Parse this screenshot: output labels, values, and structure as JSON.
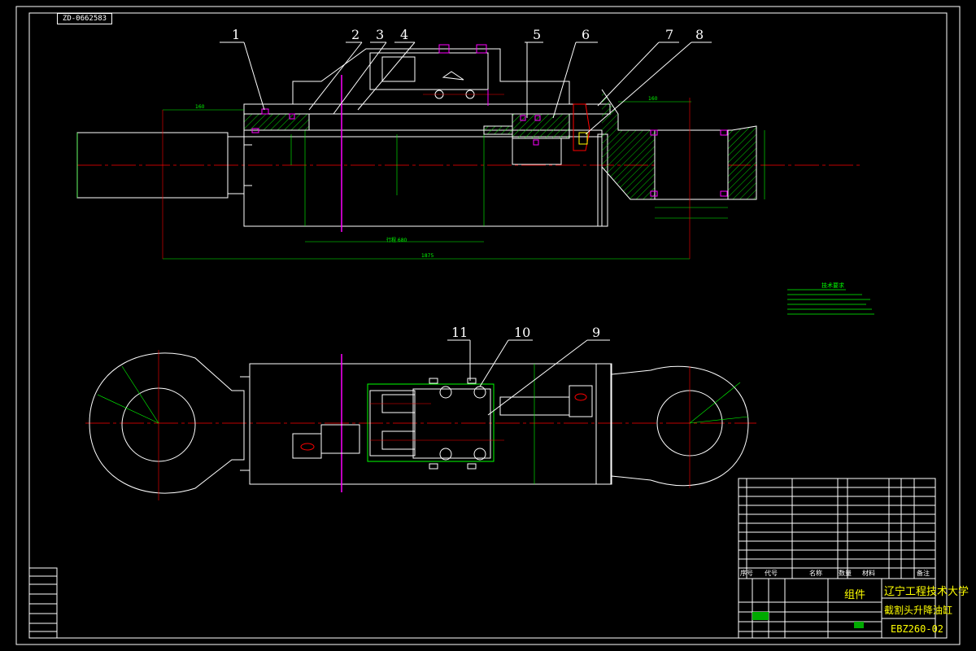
{
  "drawing_stamp": "ZD-0662583",
  "balloons": [
    "1",
    "2",
    "3",
    "4",
    "5",
    "6",
    "7",
    "8",
    "9",
    "10",
    "11"
  ],
  "title_block": {
    "university": "辽宁工程技术大学",
    "drawing_name": "截割头升降油缸",
    "drawing_code": "EBZ260-02",
    "component_label": "组件"
  },
  "notes_title": "技术要求",
  "dimensions": {
    "stroke_label": "行程 680",
    "total_length": "1875",
    "rod_left": "160",
    "rod_right": "160"
  },
  "bom_header": {
    "index": "序号",
    "code": "代号",
    "name": "名称",
    "qty": "数量",
    "material": "材料",
    "remark": "备注"
  },
  "colors": {
    "background": "#000000",
    "outline": "#ffffff",
    "centerline": "#ff0000",
    "hatch": "#00ff00",
    "accent": "#ff00ff",
    "text": "#ffff00"
  }
}
